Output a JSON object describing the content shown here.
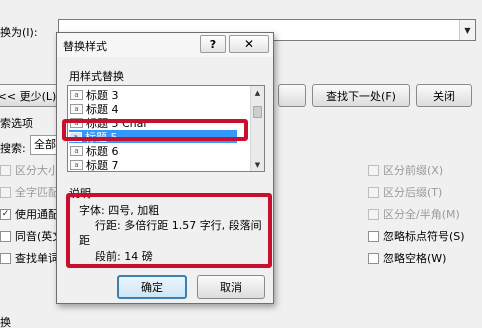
{
  "main": {
    "replace_with_label": "换为(I):",
    "fewer_button": "<< 更少(L)",
    "find_next_button": "查找下一处(F)",
    "close_button": "关闭",
    "options_label": "索选项",
    "search_label": "搜索:",
    "search_value": "全部",
    "left_options": [
      {
        "label": "区分大小",
        "checked": false,
        "disabled": true
      },
      {
        "label": "全字匹配",
        "checked": false,
        "disabled": true
      },
      {
        "label": "使用通配",
        "checked": true,
        "disabled": false
      },
      {
        "label": "同音(英文",
        "checked": false,
        "disabled": false
      },
      {
        "label": "查找单词",
        "checked": false,
        "disabled": false
      }
    ],
    "right_options": [
      {
        "label": "区分前缀(X)",
        "checked": false,
        "disabled": true
      },
      {
        "label": "区分后缀(T)",
        "checked": false,
        "disabled": true
      },
      {
        "label": "区分全/半角(M)",
        "checked": false,
        "disabled": true
      },
      {
        "label": "忽略标点符号(S)",
        "checked": false,
        "disabled": false
      },
      {
        "label": "忽略空格(W)",
        "checked": false,
        "disabled": false
      }
    ],
    "bottom_label": "换"
  },
  "dialog": {
    "title": "替换样式",
    "help_symbol": "?",
    "close_symbol": "✕",
    "list_label": "用样式替换",
    "styles": [
      "标题 3",
      "标题 4",
      "标题 5 Char",
      "标题 5",
      "标题 6",
      "标题 7"
    ],
    "selected_index": 3,
    "style_icon": "a",
    "description_label": "说明",
    "description": {
      "line1": "字体: 四号, 加粗",
      "line2": "行距: 多倍行距 1.57 字行, 段落间",
      "line3": "距",
      "line4": "段前: 14 磅"
    },
    "ok_button": "确定",
    "cancel_button": "取消"
  },
  "colors": {
    "selection": "#3399ff",
    "annotation_red": "#c8102e"
  }
}
